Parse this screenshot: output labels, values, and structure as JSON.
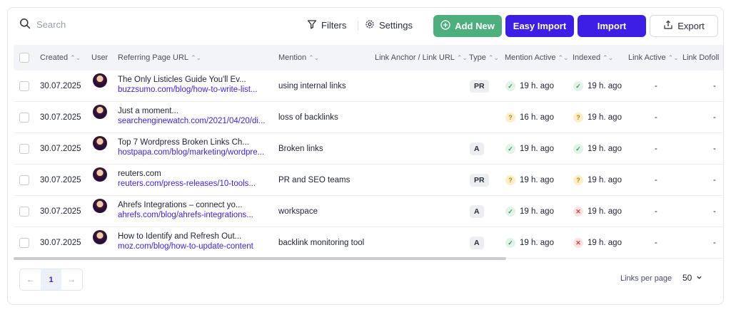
{
  "toolbar": {
    "search_placeholder": "Search",
    "filters_label": "Filters",
    "settings_label": "Settings",
    "add_new_label": "Add New",
    "easy_import_label": "Easy Import",
    "import_label": "Import",
    "export_label": "Export"
  },
  "columns": {
    "created": "Created",
    "user": "User",
    "referring_url": "Referring Page URL",
    "mention": "Mention",
    "anchor": "Link Anchor / Link URL",
    "type": "Type",
    "mention_active": "Mention Active",
    "indexed": "Indexed",
    "link_active": "Link Active",
    "link_dofollow": "Link Dofoll"
  },
  "rows": [
    {
      "created": "30.07.2025",
      "title": "The Only Listicles Guide You'll Ev...",
      "url": "buzzsumo.com/blog/how-to-write-list...",
      "mention": "using internal links",
      "type": "PR",
      "mention_active": {
        "status": "ok",
        "text": "19 h. ago"
      },
      "indexed": {
        "status": "ok",
        "text": "19 h. ago"
      },
      "link_active": "-",
      "link_dofollow": "-"
    },
    {
      "created": "30.07.2025",
      "title": "Just a moment...",
      "url": "searchenginewatch.com/2021/04/20/di...",
      "mention": "loss of backlinks",
      "type": "",
      "mention_active": {
        "status": "warn",
        "text": "16 h. ago"
      },
      "indexed": {
        "status": "warn",
        "text": "19 h. ago"
      },
      "link_active": "-",
      "link_dofollow": "-"
    },
    {
      "created": "30.07.2025",
      "title": "Top 7 Wordpress Broken Links Ch...",
      "url": "hostpapa.com/blog/marketing/wordpre...",
      "mention": "Broken links",
      "type": "A",
      "mention_active": {
        "status": "ok",
        "text": "19 h. ago"
      },
      "indexed": {
        "status": "ok",
        "text": "19 h. ago"
      },
      "link_active": "-",
      "link_dofollow": "-"
    },
    {
      "created": "30.07.2025",
      "title": "reuters.com",
      "url": "reuters.com/press-releases/10-tools...",
      "mention": "PR and SEO teams",
      "type": "PR",
      "mention_active": {
        "status": "warn",
        "text": "19 h. ago"
      },
      "indexed": {
        "status": "warn",
        "text": "19 h. ago"
      },
      "link_active": "-",
      "link_dofollow": "-"
    },
    {
      "created": "30.07.2025",
      "title": "Ahrefs Integrations – connect yo...",
      "url": "ahrefs.com/blog/ahrefs-integrations...",
      "mention": "workspace",
      "type": "A",
      "mention_active": {
        "status": "ok",
        "text": "19 h. ago"
      },
      "indexed": {
        "status": "bad",
        "text": "19 h. ago"
      },
      "link_active": "-",
      "link_dofollow": "-"
    },
    {
      "created": "30.07.2025",
      "title": "How to Identify and Refresh Out...",
      "url": "moz.com/blog/how-to-update-content",
      "mention": "backlink monitoring tool",
      "type": "A",
      "mention_active": {
        "status": "ok",
        "text": "19 h. ago"
      },
      "indexed": {
        "status": "bad",
        "text": "19 h. ago"
      },
      "link_active": "-",
      "link_dofollow": "-"
    }
  ],
  "pagination": {
    "prev": "←",
    "current_page": "1",
    "next": "→",
    "links_per_page_label": "Links per page",
    "links_per_page_value": "50"
  },
  "colors": {
    "primary": "#3d1ee6",
    "add_new": "#4dae7e",
    "ok": "#2f9a62",
    "warn": "#b9850b",
    "bad": "#d14545"
  }
}
